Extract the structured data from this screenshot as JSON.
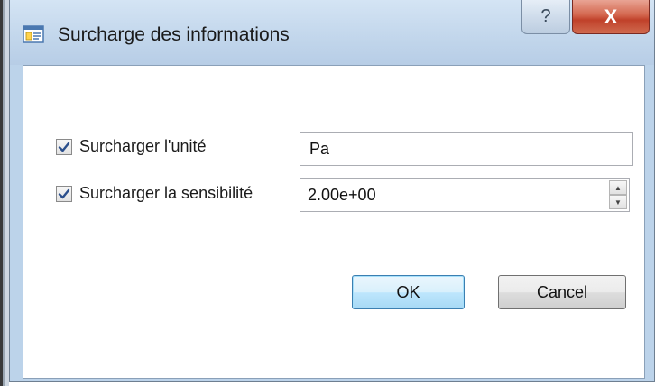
{
  "window": {
    "title": "Surcharge des informations",
    "help_label": "?",
    "close_label": "X"
  },
  "form": {
    "override_unit": {
      "label": "Surcharger l'unité",
      "checked": true,
      "value": "Pa"
    },
    "override_sensitivity": {
      "label": "Surcharger la sensibilité",
      "checked": true,
      "value": "2.00e+00"
    }
  },
  "buttons": {
    "ok_label": "OK",
    "cancel_label": "Cancel"
  }
}
